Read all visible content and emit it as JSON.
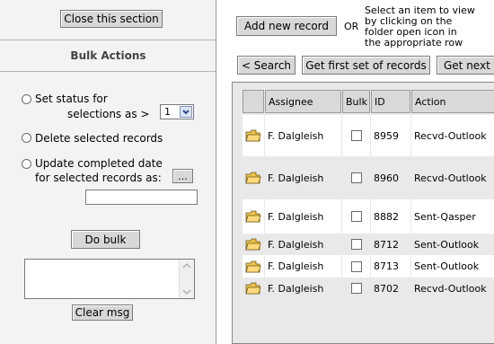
{
  "left": {
    "close_label": "Close this section",
    "section_title": "Bulk Actions",
    "opt_status_line1": "Set status for",
    "opt_status_line2": "selections as >",
    "status_select_value": "1",
    "opt_delete": "Delete selected records",
    "opt_update_line1": "Update completed date",
    "opt_update_line2": "for selected records as:",
    "ellipsis_label": "...",
    "date_value": "",
    "do_bulk_label": "Do bulk",
    "msg_value": "",
    "clear_msg_label": "Clear msg"
  },
  "top": {
    "add_label": "Add new record",
    "or_label": "OR",
    "hint": "Select an item to view by clicking on the folder open icon in the appropriate row",
    "hint_lines": [
      "Select an item to view",
      "by clicking on the",
      "folder open icon in",
      "the appropriate row"
    ]
  },
  "nav": {
    "search_label": "< Search",
    "first_label": "Get first set of records",
    "next_label": "Get next s"
  },
  "table": {
    "headers": [
      "",
      "Assignee",
      "Bulk",
      "ID",
      "Action"
    ],
    "rows": [
      {
        "assignee": "F. Dalgleish",
        "id": "8959",
        "action": "Recvd-Outlook"
      },
      {
        "assignee": "F. Dalgleish",
        "id": "8960",
        "action": "Recvd-Outlook"
      },
      {
        "assignee": "F. Dalgleish",
        "id": "8882",
        "action": "Sent-Qasper"
      },
      {
        "assignee": "F. Dalgleish",
        "id": "8712",
        "action": "Sent-Outlook"
      },
      {
        "assignee": "F. Dalgleish",
        "id": "8713",
        "action": "Sent-Outlook"
      },
      {
        "assignee": "F. Dalgleish",
        "id": "8702",
        "action": "Recvd-Outlook"
      }
    ]
  },
  "icons": {
    "folder": "folder-open-icon",
    "select_arrow": "chevron-down-icon",
    "scroll_up": "scroll-up-arrow-icon",
    "scroll_down": "scroll-down-arrow-icon"
  }
}
